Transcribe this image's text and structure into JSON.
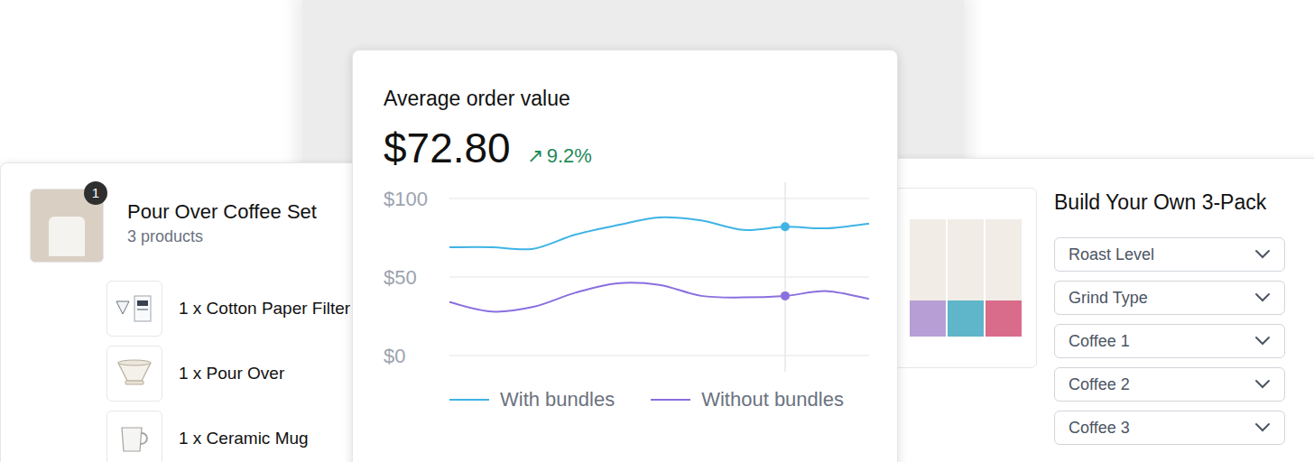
{
  "bundle_card": {
    "badge": "1",
    "title": "Pour Over Coffee Set",
    "subtitle": "3 products",
    "items": [
      {
        "label": "1 x Cotton Paper Filter",
        "kind": "filter"
      },
      {
        "label": "1 x Pour Over",
        "kind": "dripper"
      },
      {
        "label": "1 x Ceramic Mug",
        "kind": "mug"
      }
    ]
  },
  "chart": {
    "title": "Average order value",
    "value": "$72.80",
    "change_icon": "↗",
    "change": "9.2%",
    "y_ticks": [
      {
        "label": "$100",
        "value": 100
      },
      {
        "label": "$50",
        "value": 50
      },
      {
        "label": "$0",
        "value": 0
      }
    ],
    "highlight_index": 8,
    "series": [
      {
        "name": "With bundles",
        "color": "#3fb4e5",
        "values": [
          69,
          69,
          68,
          77,
          83,
          88,
          86,
          80,
          82,
          81,
          84
        ]
      },
      {
        "name": "Without bundles",
        "color": "#8a6fdf",
        "values": [
          34,
          28,
          31,
          40,
          46,
          45,
          38,
          37,
          38,
          41,
          36
        ]
      }
    ]
  },
  "builder": {
    "title": "Build Your Own 3-Pack",
    "selects": [
      "Roast Level",
      "Grind Type",
      "Coffee 1",
      "Coffee 2",
      "Coffee 3"
    ]
  }
}
